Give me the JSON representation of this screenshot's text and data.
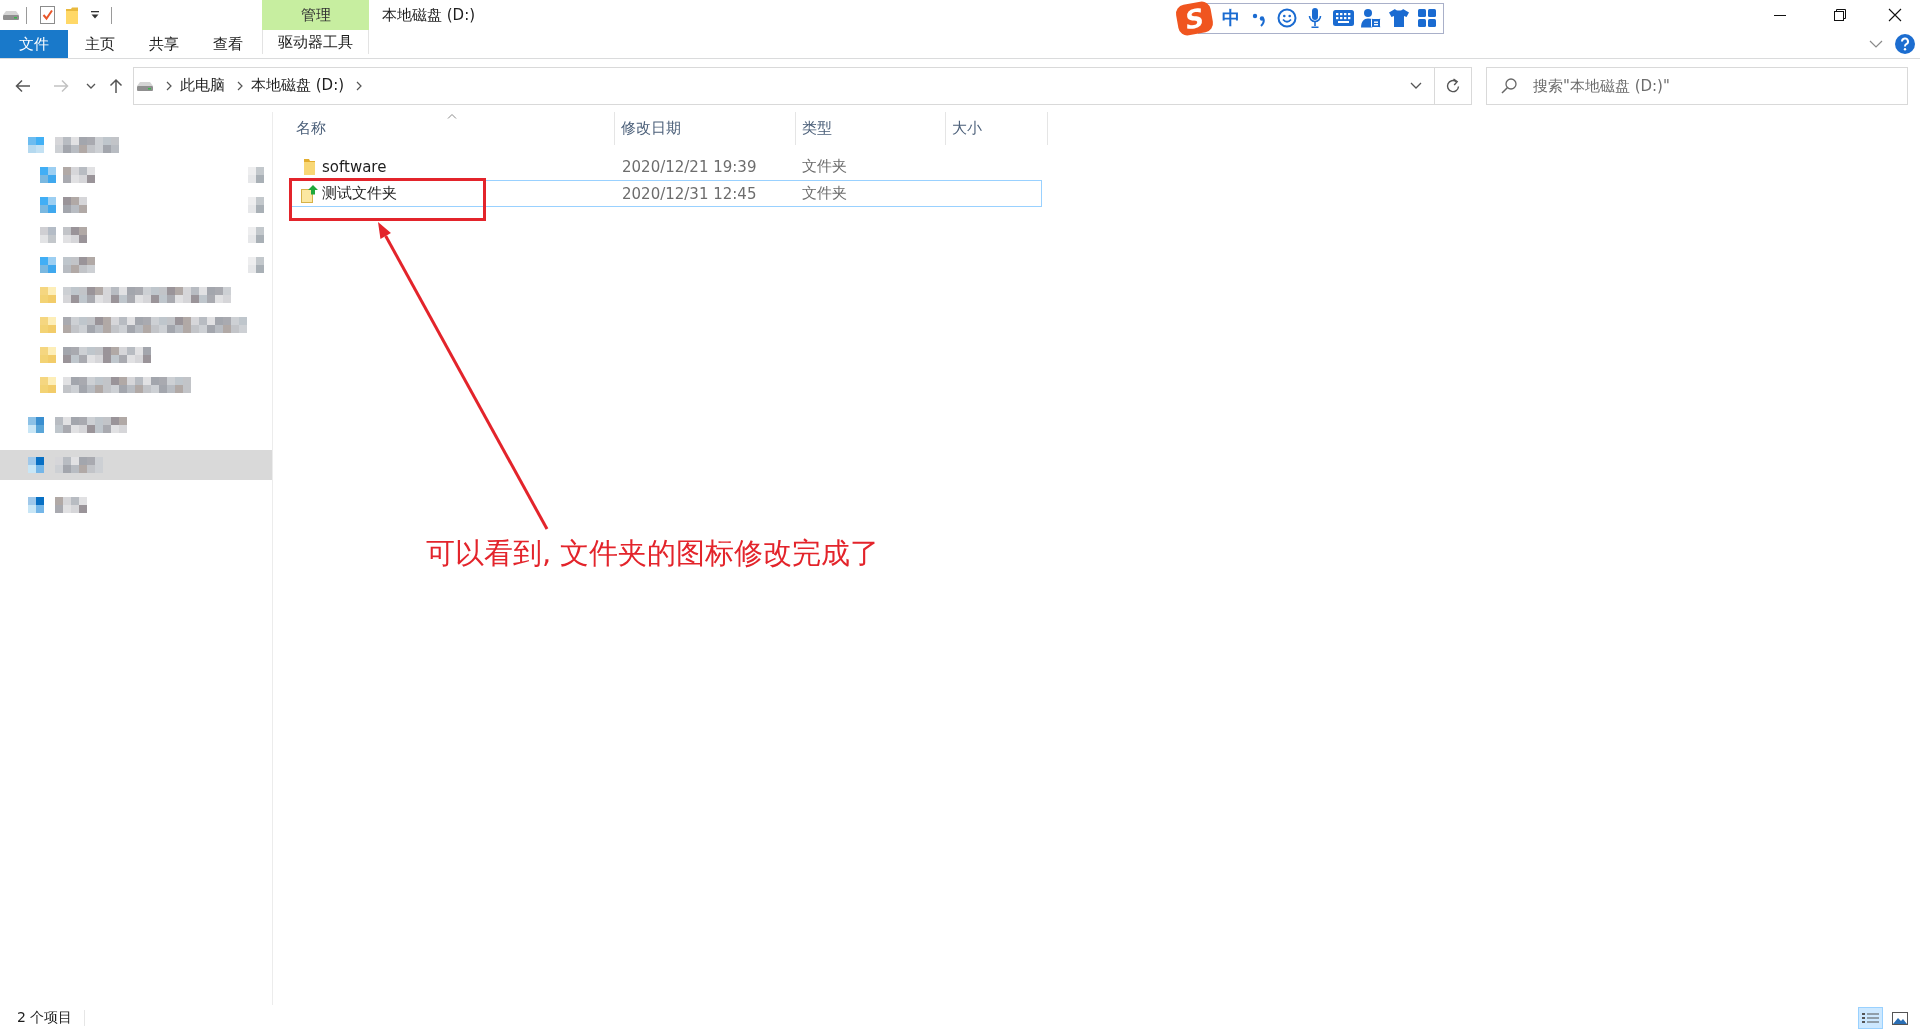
{
  "window": {
    "title": "本地磁盘 (D:)"
  },
  "ribbon": {
    "context_header": "管理",
    "tabs": [
      {
        "label": "文件",
        "kind": "file"
      },
      {
        "label": "主页",
        "kind": "tab"
      },
      {
        "label": "共享",
        "kind": "tab"
      },
      {
        "label": "查看",
        "kind": "tab"
      },
      {
        "label": "驱动器工具",
        "kind": "contextual"
      }
    ]
  },
  "ime_toolbar": {
    "logo": "S",
    "mode": "中"
  },
  "nav_buttons": [
    {
      "kind": "back",
      "disabled": false
    },
    {
      "kind": "forward",
      "disabled": true
    },
    {
      "kind": "recent",
      "disabled": false
    },
    {
      "kind": "up",
      "disabled": false
    }
  ],
  "address_bar": {
    "breadcrumbs": [
      "此电脑",
      "本地磁盘 (D:)"
    ]
  },
  "search": {
    "placeholder": "搜索\"本地磁盘 (D:)\""
  },
  "sidebar": {
    "items": [
      {
        "kind": "star",
        "selected": false,
        "children": [
          {
            "kind": "system",
            "pinned": true,
            "selected": false
          },
          {
            "kind": "system",
            "pinned": true,
            "selected": false
          },
          {
            "kind": "drive",
            "pinned": true,
            "selected": false
          },
          {
            "kind": "system",
            "pinned": true,
            "selected": false
          },
          {
            "kind": "folder",
            "pinned": false,
            "selected": false
          },
          {
            "kind": "folder",
            "pinned": false,
            "selected": false
          },
          {
            "kind": "folder",
            "pinned": false,
            "selected": false
          },
          {
            "kind": "folder",
            "pinned": false,
            "selected": false
          }
        ]
      },
      {
        "kind": "pc",
        "selected": false
      },
      {
        "kind": "network",
        "selected": true
      },
      {
        "kind": "network",
        "selected": false
      }
    ]
  },
  "file_list": {
    "columns": [
      {
        "label": "名称",
        "sorted": true
      },
      {
        "label": "修改日期",
        "sorted": false
      },
      {
        "label": "类型",
        "sorted": false
      },
      {
        "label": "大小",
        "sorted": false
      }
    ],
    "rows": [
      {
        "kind": "folder",
        "name": "software",
        "modified": "2020/12/21 19:39",
        "type": "文件夹",
        "selected": false
      },
      {
        "kind": "custom_folder",
        "name": "测试文件夹",
        "modified": "2020/12/31 12:45",
        "type": "文件夹",
        "selected": true
      }
    ]
  },
  "annotation": {
    "text": "可以看到, 文件夹的图标修改完成了"
  },
  "status_bar": {
    "item_count": "2 个项目",
    "views": [
      {
        "kind": "details",
        "selected": true
      },
      {
        "kind": "large_icons",
        "selected": false
      }
    ]
  }
}
